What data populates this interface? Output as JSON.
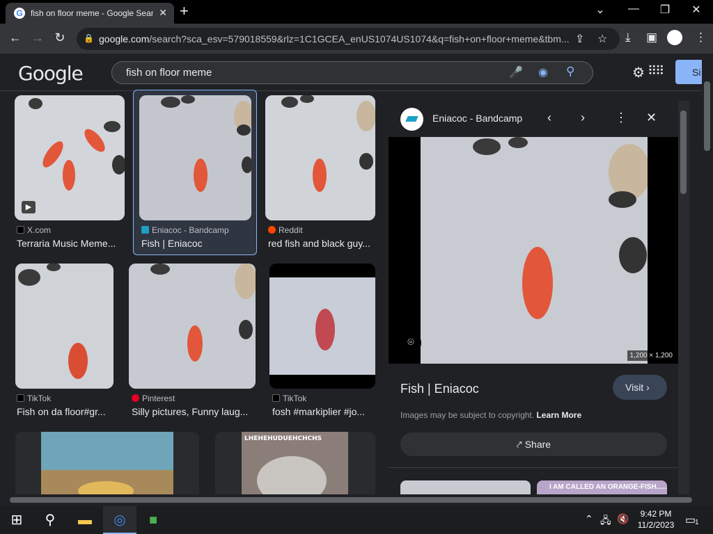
{
  "tab": {
    "title": "fish on floor meme - Google Search",
    "close": "✕",
    "new_tab": "+"
  },
  "window": {
    "minimize": "—",
    "maximize": "❐",
    "close": "✕",
    "tab_search": "⌄"
  },
  "toolbar": {
    "url_host": "google.com",
    "url_rest": "/search?sca_esv=579018559&rlz=1C1GCEA_enUS1074US1074&q=fish+on+floor+meme&tbm...",
    "back": "←",
    "forward": "→",
    "reload": "↻"
  },
  "google": {
    "logo": "Google",
    "query": "fish on floor meme",
    "signin": "Si"
  },
  "results": [
    {
      "source": "X.com",
      "caption": "Terraria Music Meme...",
      "src_color": "#000000"
    },
    {
      "source": "Eniacoc - Bandcamp",
      "caption": "Fish | Eniacoc",
      "src_color": "#1da0c3"
    },
    {
      "source": "Reddit",
      "caption": "red fish and black guy...",
      "src_color": "#ff4500"
    },
    {
      "source": "TikTok",
      "caption": "Fish on da floor#gr...",
      "src_color": "#000000"
    },
    {
      "source": "Pinterest",
      "caption": "Silly pictures, Funny laug...",
      "src_color": "#e60023"
    },
    {
      "source": "TikTok",
      "caption": "fosh #markiplier #jo...",
      "src_color": "#000000"
    }
  ],
  "bottom_thumb_text": "LHEHEHUDUEHCHCHS",
  "panel": {
    "site": "Eniacoc - Bandcamp",
    "dims": "1,200 × 1,200",
    "title": "Fish | Eniacoc",
    "visit": "Visit",
    "copyright": "Images may be subject to copyright.",
    "learn_more": "Learn More",
    "share": "Share",
    "related_text": "I AM CALLED AN ORANGE-FISH......"
  },
  "taskbar": {
    "time": "9:42 PM",
    "date": "11/2/2023",
    "notifications": "1"
  },
  "colors": {
    "accent": "#8ab4f8",
    "bg": "#202124",
    "fish": "#e2563a"
  }
}
